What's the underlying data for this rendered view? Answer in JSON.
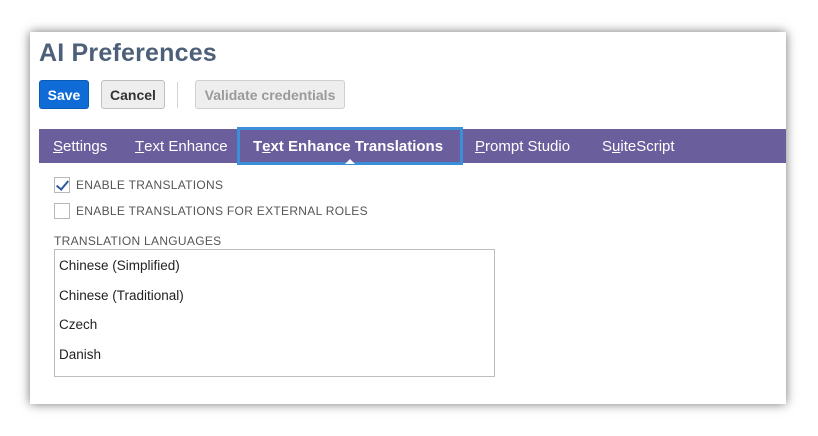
{
  "page": {
    "title": "AI Preferences"
  },
  "toolbar": {
    "save_label": "Save",
    "cancel_label": "Cancel",
    "validate_label": "Validate credentials"
  },
  "tabs": [
    {
      "mnemonic": "S",
      "rest": "ettings",
      "active": false
    },
    {
      "mnemonic": "T",
      "rest": "ext Enhance",
      "active": false
    },
    {
      "prefix": "T",
      "mnemonic": "e",
      "rest": "xt Enhance Translations",
      "active": true
    },
    {
      "mnemonic": "P",
      "rest": "rompt Studio",
      "active": false
    },
    {
      "prefix": "S",
      "mnemonic": "u",
      "rest": "iteScript",
      "active": false
    }
  ],
  "options": {
    "enable_translations": {
      "label": "ENABLE TRANSLATIONS",
      "checked": true
    },
    "enable_external": {
      "label": "ENABLE TRANSLATIONS FOR EXTERNAL ROLES",
      "checked": false
    }
  },
  "languages": {
    "label": "TRANSLATION LANGUAGES",
    "items": [
      "Chinese (Simplified)",
      "Chinese (Traditional)",
      "Czech",
      "Danish"
    ]
  },
  "colors": {
    "title": "#4d5f79",
    "save_button": "#0f6cd6",
    "tab_bar": "#6a5e9c",
    "active_tab_outline": "#3a8fd8"
  }
}
